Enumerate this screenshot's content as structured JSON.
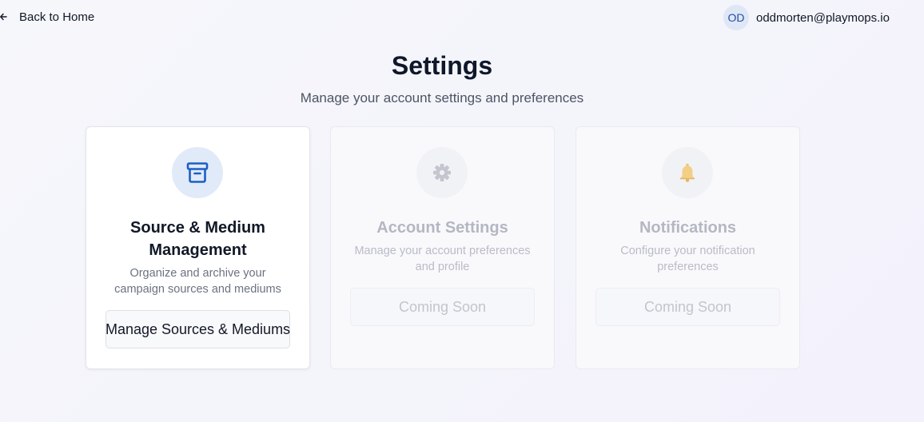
{
  "header": {
    "back_label": "Back to Home",
    "user": {
      "initials": "OD",
      "email": "oddmorten@playmops.io"
    }
  },
  "page": {
    "title": "Settings",
    "subtitle": "Manage your account settings and preferences"
  },
  "cards": [
    {
      "icon": "archive-icon",
      "title": "Source & Medium Management",
      "description": "Organize and archive your campaign sources and mediums",
      "button_label": "Manage Sources & Mediums",
      "enabled": true
    },
    {
      "icon": "gear-icon",
      "title": "Account Settings",
      "description": "Manage your account preferences and profile",
      "button_label": "Coming Soon",
      "enabled": false
    },
    {
      "icon": "bell-icon",
      "title": "Notifications",
      "description": "Configure your notification preferences",
      "button_label": "Coming Soon",
      "enabled": false
    }
  ],
  "colors": {
    "accent": "#1d5fc4",
    "icon_bg_active": "#e1eaf8",
    "icon_bg_disabled": "#f1f2f6"
  }
}
